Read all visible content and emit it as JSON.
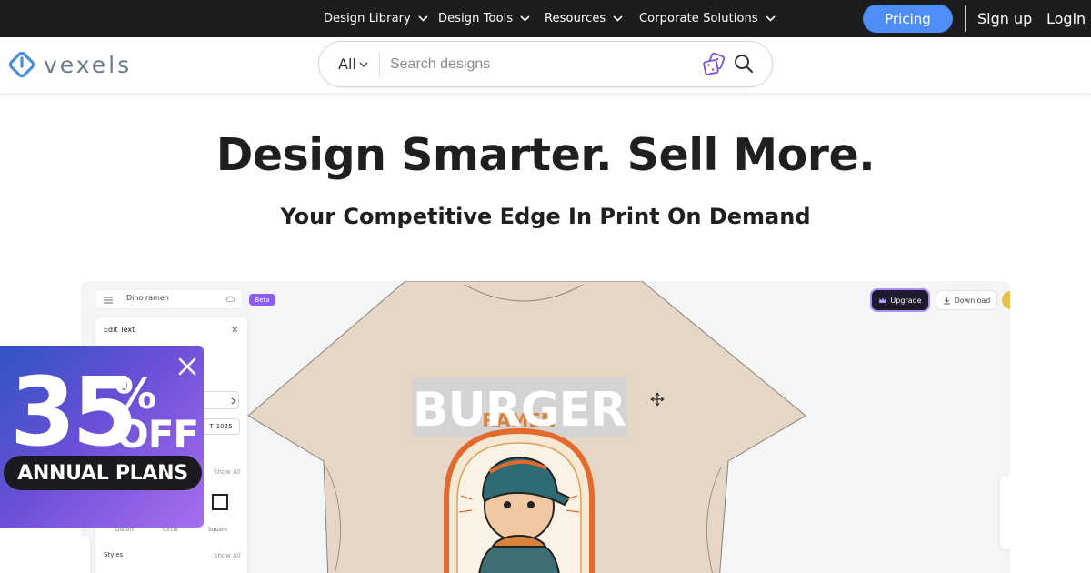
{
  "nav": {
    "items": [
      {
        "label": "Design Library"
      },
      {
        "label": "Design Tools"
      },
      {
        "label": "Resources"
      },
      {
        "label": "Corporate Solutions"
      }
    ],
    "pricing": "Pricing",
    "signup": "Sign up",
    "login": "Login"
  },
  "header": {
    "logo": "vexels",
    "search": {
      "category": "All",
      "placeholder": "Search designs"
    }
  },
  "hero": {
    "title": "Design Smarter. Sell More.",
    "subtitle": "Your Competitive Edge In Print On Demand"
  },
  "editor": {
    "doc_name": "Dino ramen",
    "beta": "Beta",
    "upgrade": "Upgrade",
    "download": "Download",
    "panel": {
      "title": "Edit Text",
      "size": "1025",
      "show_all": "Show All",
      "shape_labels": [
        "Distort",
        "Circle",
        "Square"
      ],
      "styles": "Styles",
      "styles_show_all": "Show All"
    },
    "design_text": "BURGER",
    "design_subtext": "RAMEN"
  },
  "promo": {
    "number": "35",
    "percent": "%",
    "off": "OFF",
    "badge": "ANNUAL PLANS"
  },
  "colors": {
    "nav_bg": "#1d1d1f",
    "accent": "#4f8ef7",
    "shirt": "#e6d6c6",
    "promo_start": "#2f55c4",
    "promo_end": "#a86ef0"
  }
}
